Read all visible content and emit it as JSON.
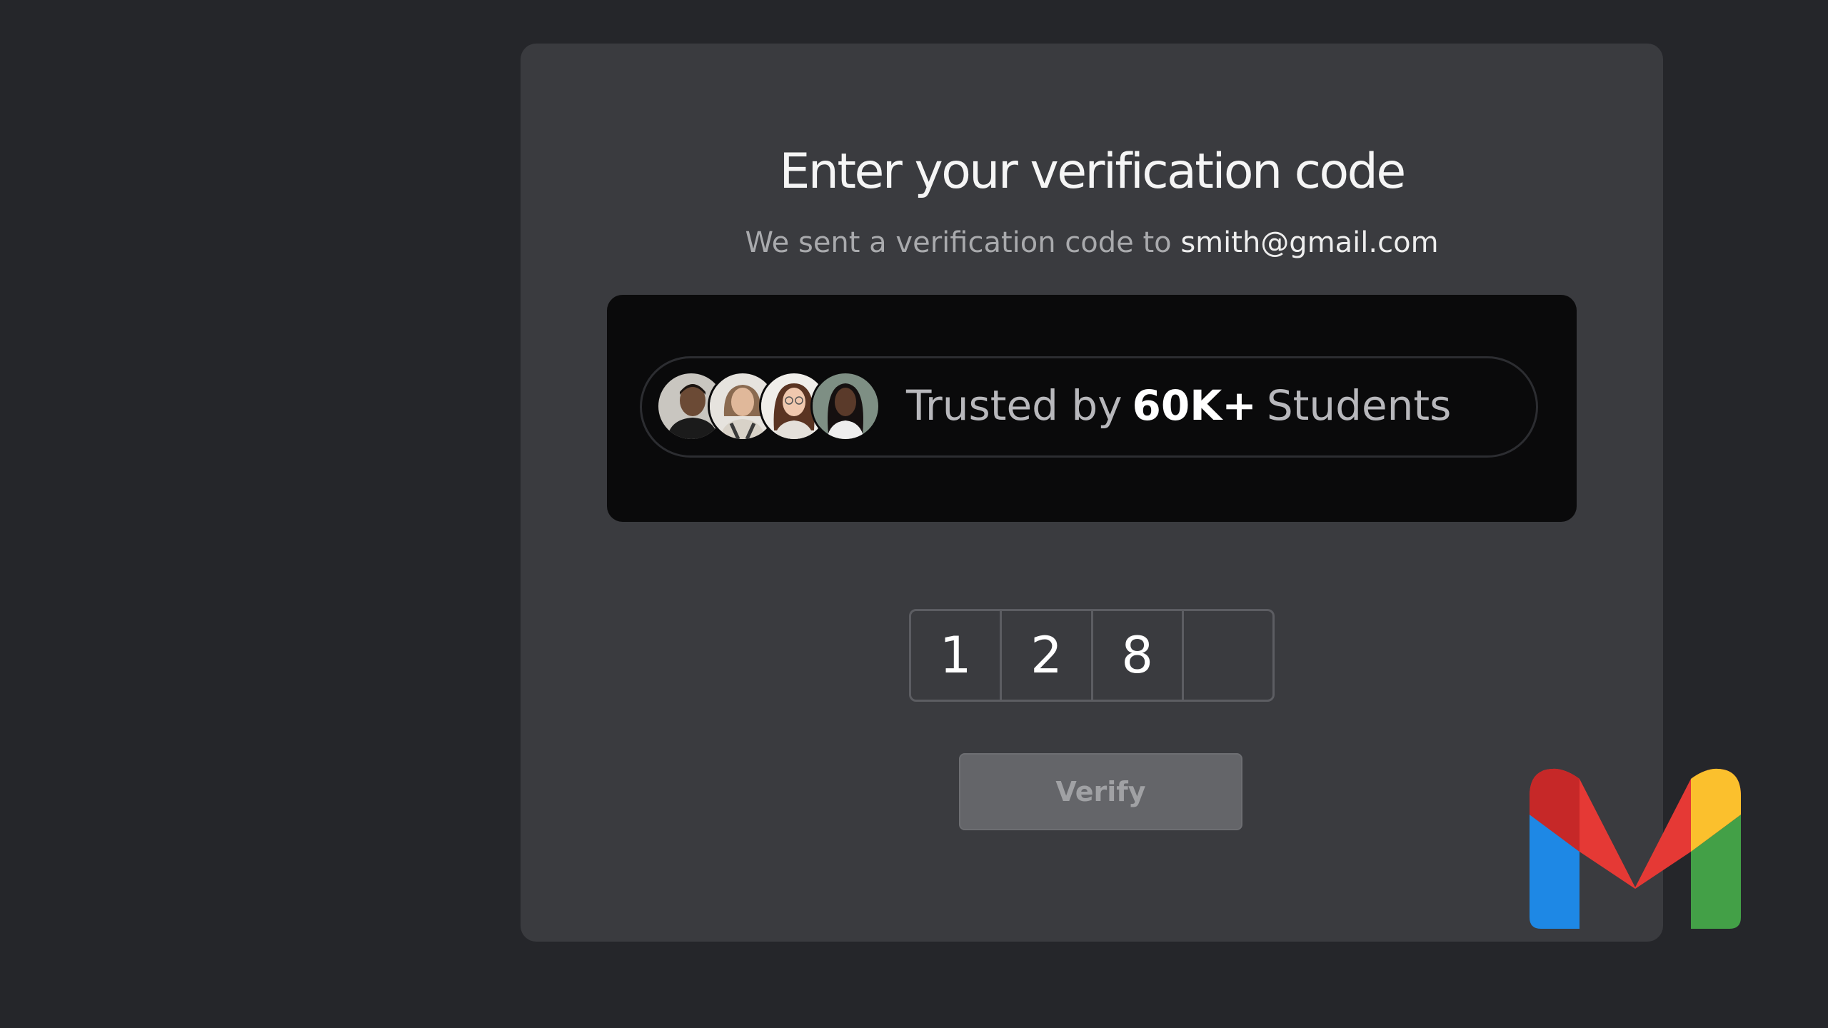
{
  "verification": {
    "title": "Enter your verification code",
    "subtitle_prefix": "We sent a verification code to",
    "email": "smith@gmail.com"
  },
  "promo": {
    "trusted_prefix": "Trusted by",
    "trusted_count": "60K+",
    "trusted_suffix": "Students",
    "avatars": [
      "student-avatar-1",
      "student-avatar-2",
      "student-avatar-3",
      "student-avatar-4"
    ]
  },
  "code": {
    "digits": [
      "1",
      "2",
      "8",
      ""
    ]
  },
  "verify_button": {
    "label": "Verify"
  },
  "brand": {
    "logo": "gmail-logo",
    "colors": {
      "red": "#ea4335",
      "blue": "#4285f4",
      "green": "#34a853",
      "yellow": "#fbbc04",
      "dark_red": "#c5221f"
    }
  }
}
